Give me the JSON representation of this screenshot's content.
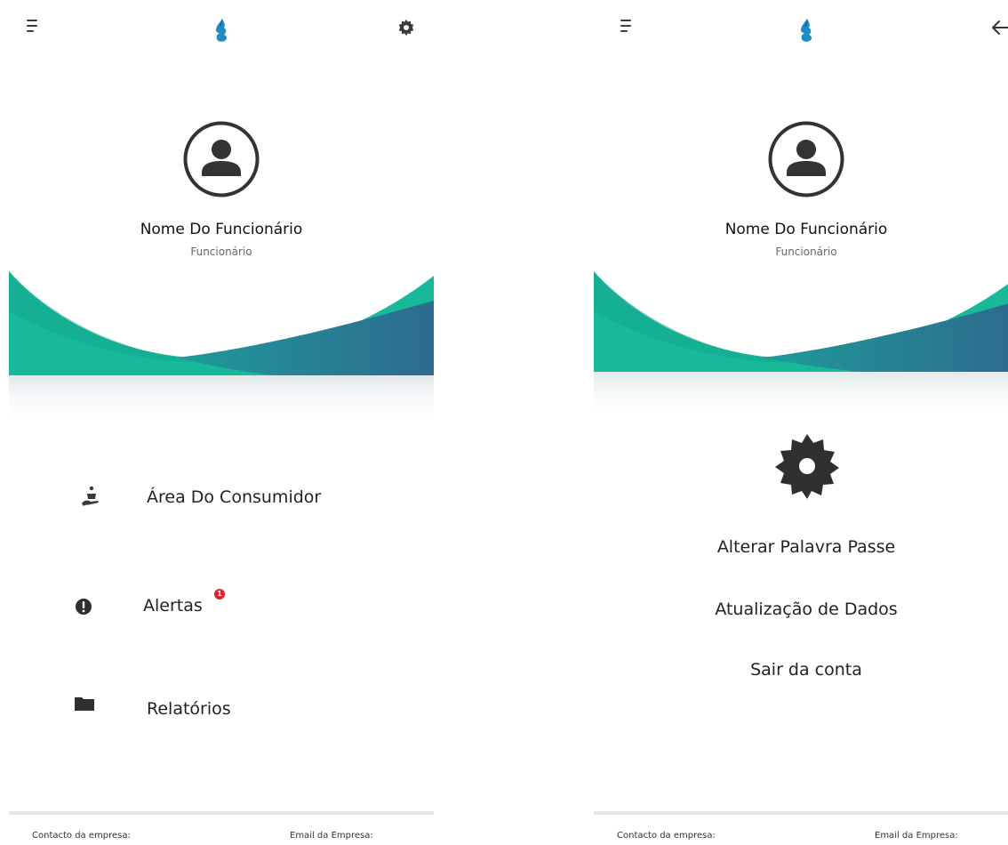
{
  "colors": {
    "accent_teal": "#17b99a",
    "accent_blue": "#2e6f93",
    "icon_dark": "#3a3a3a",
    "badge_red": "#e0202a"
  },
  "left_screen": {
    "topbar": {
      "menu_icon": "hamburger-icon",
      "logo_icon": "water-drop-logo",
      "settings_icon": "gear-icon"
    },
    "profile": {
      "name": "Nome Do Funcionário",
      "role": "Funcionário",
      "avatar_icon": "user-circle-icon"
    },
    "menu": [
      {
        "label": "Área Do Consumidor",
        "icon": "consumer-care-icon"
      },
      {
        "label": "Alertas",
        "icon": "alert-circle-icon",
        "badge": "1"
      },
      {
        "label": "Relatórios",
        "icon": "folder-icon"
      }
    ],
    "footer": {
      "contact_label": "Contacto da empresa:",
      "email_label": "Email da Empresa:"
    }
  },
  "right_screen": {
    "topbar": {
      "menu_icon": "hamburger-icon",
      "logo_icon": "water-drop-logo",
      "back_icon": "arrow-left-icon"
    },
    "profile": {
      "name": "Nome Do Funcionário",
      "role": "Funcionário",
      "avatar_icon": "user-circle-icon"
    },
    "settings_icon": "gear-icon",
    "options": [
      "Alterar Palavra Passe",
      "Atualização de Dados",
      "Sair da conta"
    ],
    "footer": {
      "contact_label": "Contacto da empresa:",
      "email_label": "Email da Empresa:"
    }
  }
}
